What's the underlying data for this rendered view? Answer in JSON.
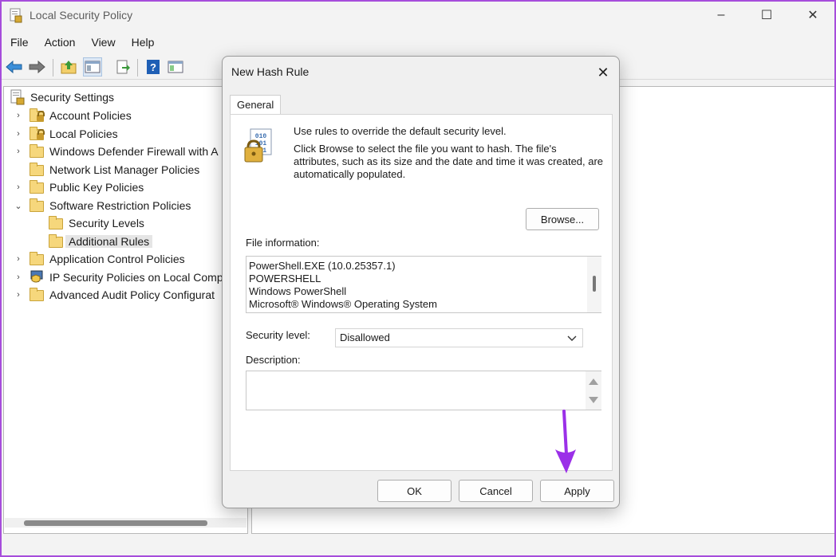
{
  "window": {
    "title": "Local Security Policy",
    "controls": {
      "minimize": "–",
      "maximize": "☐",
      "close": "✕"
    }
  },
  "menu": [
    "File",
    "Action",
    "View",
    "Help"
  ],
  "toolbar": {
    "icons": [
      "back-arrow-icon",
      "forward-arrow-icon",
      "up-folder-icon",
      "show-hide-tree-icon",
      "export-list-icon",
      "help-icon",
      "properties-icon"
    ]
  },
  "tree": {
    "root": "Security Settings",
    "items": [
      {
        "label": "Account Policies",
        "expander": "›",
        "icon": "folder-lock"
      },
      {
        "label": "Local Policies",
        "expander": "›",
        "icon": "folder-lock"
      },
      {
        "label": "Windows Defender Firewall with A",
        "expander": "›",
        "icon": "folder"
      },
      {
        "label": "Network List Manager Policies",
        "expander": "",
        "icon": "folder"
      },
      {
        "label": "Public Key Policies",
        "expander": "›",
        "icon": "folder"
      },
      {
        "label": "Software Restriction Policies",
        "expander": "⌄",
        "icon": "folder"
      },
      {
        "label": "Security Levels",
        "expander": "",
        "icon": "folder"
      },
      {
        "label": "Additional Rules",
        "expander": "",
        "icon": "folder"
      },
      {
        "label": "Application Control Policies",
        "expander": "›",
        "icon": "folder"
      },
      {
        "label": "IP Security Policies on Local Comp",
        "expander": "›",
        "icon": "shield-computer"
      },
      {
        "label": "Advanced Audit Policy Configurat",
        "expander": "›",
        "icon": "folder"
      }
    ]
  },
  "dialog": {
    "title": "New Hash Rule",
    "close": "✕",
    "tab": "General",
    "intro_line1": "Use rules to override the default security level.",
    "intro_line2": "Click Browse to select the file you want to hash. The file's attributes, such as its size and the date and time it was created, are automatically populated.",
    "browse_label": "Browse...",
    "file_info_label": "File information:",
    "file_info_lines": [
      "PowerShell.EXE (10.0.25357.1)",
      "POWERSHELL",
      "Windows PowerShell",
      "Microsoft® Windows® Operating System"
    ],
    "security_level_label": "Security level:",
    "security_level_value": "Disallowed",
    "description_label": "Description:",
    "description_value": "",
    "ok_label": "OK",
    "cancel_label": "Cancel",
    "apply_label": "Apply"
  },
  "colors": {
    "annotation_arrow": "#9b30e8",
    "border_accent": "#a64ddb"
  }
}
